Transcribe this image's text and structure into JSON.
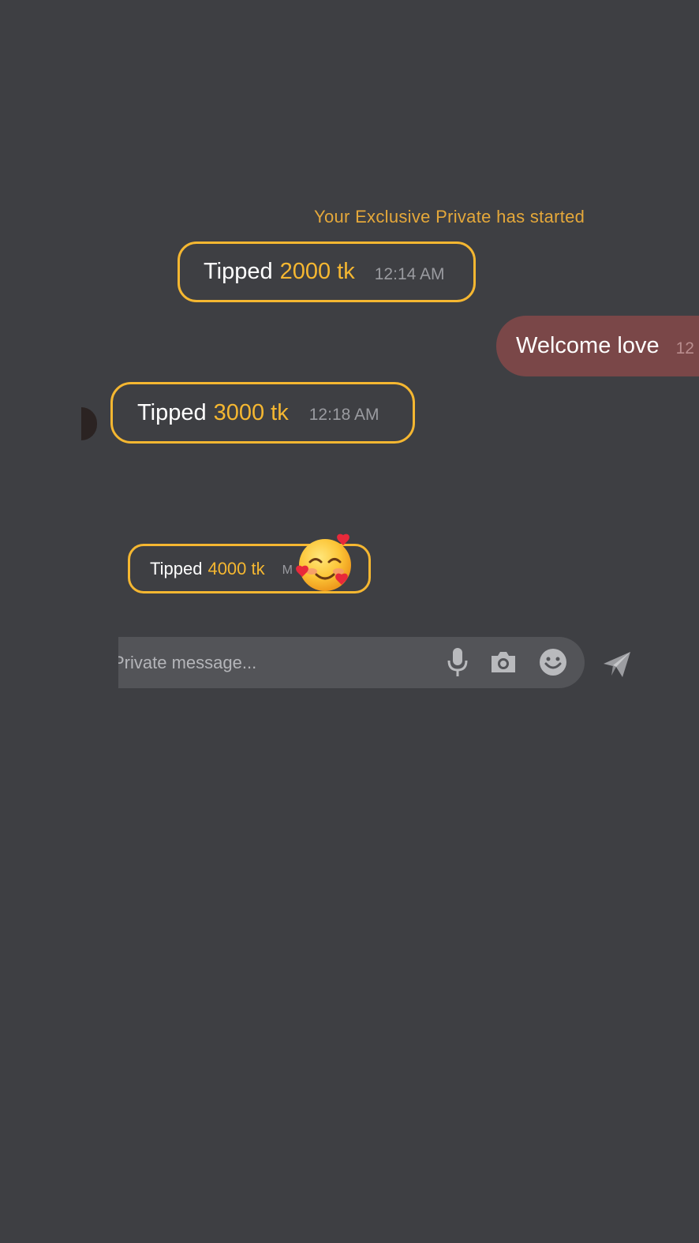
{
  "chat": {
    "system_note": "Your Exclusive Private has started",
    "messages": [
      {
        "type": "tip",
        "word": "Tipped",
        "amount": "2000 tk",
        "time": "12:14 AM"
      },
      {
        "type": "own",
        "text": "Welcome love",
        "time": "12"
      },
      {
        "type": "tip",
        "word": "Tipped",
        "amount": "3000 tk",
        "time": "12:18 AM"
      },
      {
        "type": "tip",
        "word": "Tipped",
        "amount": "4000 tk",
        "time": "M"
      }
    ],
    "sticker": "smiling-face-with-hearts-emoji"
  },
  "composer": {
    "placeholder": "Private message...",
    "value": "",
    "icons": [
      "microphone-icon",
      "camera-icon",
      "smiley-icon"
    ],
    "send_icon": "paper-plane-send-icon"
  },
  "colors": {
    "background": "#3e3f43",
    "accent": "#f5b731",
    "own_bubble": "#7a4748",
    "composer": "#535458"
  }
}
